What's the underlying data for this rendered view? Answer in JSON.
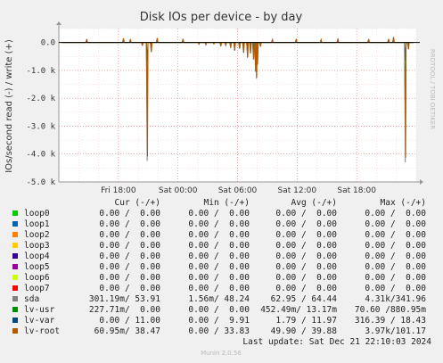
{
  "chart_data": {
    "type": "line",
    "title": "Disk IOs per device - by day",
    "ylabel": "IOs/second read (-) / write (+)",
    "side_text": "RRDTOOL / TOBI OETIKER",
    "ylim": [
      -5.0,
      0.5
    ],
    "y_ticks": [
      {
        "value": 0.0,
        "label": "0.0"
      },
      {
        "value": -1.0,
        "label": "-1.0 k"
      },
      {
        "value": -2.0,
        "label": "-2.0 k"
      },
      {
        "value": -3.0,
        "label": "-3.0 k"
      },
      {
        "value": -4.0,
        "label": "-4.0 k"
      },
      {
        "value": -5.0,
        "label": "-5.0 k"
      }
    ],
    "xlim": [
      0,
      36
    ],
    "x_ticks": [
      {
        "value": 6,
        "label": "Fri 18:00"
      },
      {
        "value": 12,
        "label": "Sat 00:00"
      },
      {
        "value": 18,
        "label": "Sat 06:00"
      },
      {
        "value": 24,
        "label": "Sat 12:00"
      },
      {
        "value": 30,
        "label": "Sat 18:00"
      }
    ],
    "legend_header": {
      "cur": "Cur (-/+)",
      "min": "Min (-/+)",
      "avg": "Avg (-/+)",
      "max": "Max (-/+)"
    },
    "series": [
      {
        "name": "loop0",
        "color": "#00cc00",
        "cur": "0.00 /  0.00",
        "min": "0.00 /  0.00",
        "avg": "0.00 /  0.00",
        "max": "0.00 /  0.00"
      },
      {
        "name": "loop1",
        "color": "#0066b3",
        "cur": "0.00 /  0.00",
        "min": "0.00 /  0.00",
        "avg": "0.00 /  0.00",
        "max": "0.00 /  0.00"
      },
      {
        "name": "loop2",
        "color": "#ff8000",
        "cur": "0.00 /  0.00",
        "min": "0.00 /  0.00",
        "avg": "0.00 /  0.00",
        "max": "0.00 /  0.00"
      },
      {
        "name": "loop3",
        "color": "#ffcc00",
        "cur": "0.00 /  0.00",
        "min": "0.00 /  0.00",
        "avg": "0.00 /  0.00",
        "max": "0.00 /  0.00"
      },
      {
        "name": "loop4",
        "color": "#330099",
        "cur": "0.00 /  0.00",
        "min": "0.00 /  0.00",
        "avg": "0.00 /  0.00",
        "max": "0.00 /  0.00"
      },
      {
        "name": "loop5",
        "color": "#990099",
        "cur": "0.00 /  0.00",
        "min": "0.00 /  0.00",
        "avg": "0.00 /  0.00",
        "max": "0.00 /  0.00"
      },
      {
        "name": "loop6",
        "color": "#ccff00",
        "cur": "0.00 /  0.00",
        "min": "0.00 /  0.00",
        "avg": "0.00 /  0.00",
        "max": "0.00 /  0.00"
      },
      {
        "name": "loop7",
        "color": "#ff0000",
        "cur": "0.00 /  0.00",
        "min": "0.00 /  0.00",
        "avg": "0.00 /  0.00",
        "max": "0.00 /  0.00"
      },
      {
        "name": "sda",
        "color": "#808080",
        "cur": "301.19m/ 53.91",
        "min": "1.56m/ 48.24",
        "avg": "62.95 / 64.44",
        "max": "4.31k/341.96"
      },
      {
        "name": "lv-usr",
        "color": "#008f00",
        "cur": "227.71m/  0.00",
        "min": "0.00 /  0.00",
        "avg": "452.49m/ 13.17m",
        "max": "70.60 /880.95m"
      },
      {
        "name": "lv-var",
        "color": "#00487d",
        "cur": "0.00 / 11.00",
        "min": "0.00 /  9.91",
        "avg": "1.79 / 11.97",
        "max": "316.39 / 18.43"
      },
      {
        "name": "lv-root",
        "color": "#b35a00",
        "cur": "60.95m/ 38.47",
        "min": "0.00 / 33.83",
        "avg": "49.90 / 39.88",
        "max": "3.97k/101.17"
      }
    ],
    "spikes": [
      {
        "x": 2.8,
        "y": 0.12
      },
      {
        "x": 6.5,
        "y": 0.15
      },
      {
        "x": 7.2,
        "y": 0.12
      },
      {
        "x": 8.4,
        "y": -0.12
      },
      {
        "x": 8.9,
        "y": -4.25
      },
      {
        "x": 9.3,
        "y": -0.35
      },
      {
        "x": 9.9,
        "y": 0.16
      },
      {
        "x": 12.5,
        "y": 0.13
      },
      {
        "x": 14.1,
        "y": -0.06
      },
      {
        "x": 14.8,
        "y": -0.08
      },
      {
        "x": 15.6,
        "y": -0.05
      },
      {
        "x": 16.3,
        "y": -0.14
      },
      {
        "x": 16.8,
        "y": -0.1
      },
      {
        "x": 17.3,
        "y": -0.2
      },
      {
        "x": 17.7,
        "y": -0.3
      },
      {
        "x": 18.2,
        "y": -0.22
      },
      {
        "x": 18.6,
        "y": -0.38
      },
      {
        "x": 19.0,
        "y": -0.55
      },
      {
        "x": 19.3,
        "y": -0.4
      },
      {
        "x": 19.6,
        "y": -0.62
      },
      {
        "x": 19.8,
        "y": -1.05
      },
      {
        "x": 19.9,
        "y": -1.3
      },
      {
        "x": 20.0,
        "y": -0.8
      },
      {
        "x": 20.3,
        "y": -0.15
      },
      {
        "x": 21.5,
        "y": 0.1
      },
      {
        "x": 23.9,
        "y": 0.13
      },
      {
        "x": 26.4,
        "y": 0.1
      },
      {
        "x": 28.1,
        "y": 0.14
      },
      {
        "x": 31.2,
        "y": 0.12
      },
      {
        "x": 33.2,
        "y": 0.13
      },
      {
        "x": 33.7,
        "y": 0.2
      },
      {
        "x": 34.9,
        "y": -4.3
      },
      {
        "x": 35.2,
        "y": -0.25
      }
    ],
    "last_update": "Last update: Sat Dec 21 22:10:03 2024",
    "footer": "Munin 2.0.56"
  }
}
